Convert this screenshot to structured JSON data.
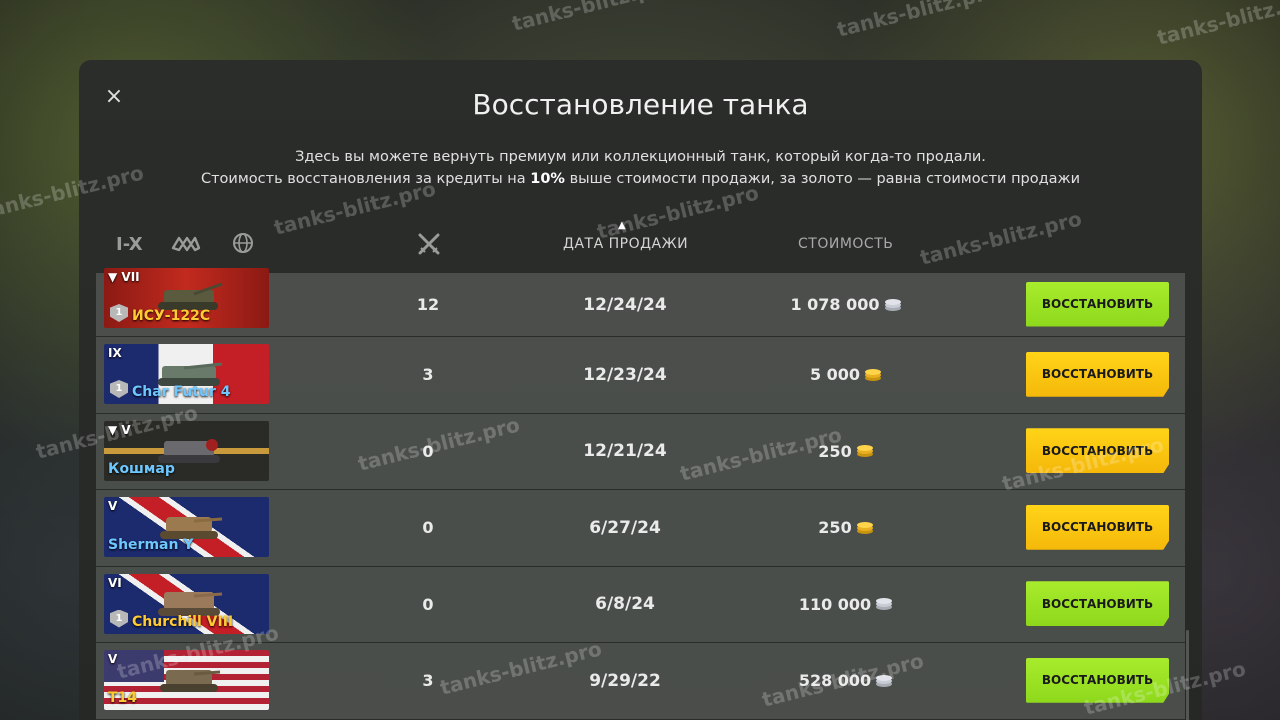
{
  "dialog": {
    "title": "Восстановление танка",
    "subtitle_line1": "Здесь вы можете вернуть премиум или коллекционный танк, который когда-то продали.",
    "subtitle_line2_pre": "Стоимость восстановления за кредиты на ",
    "subtitle_line2_bold": "10%",
    "subtitle_line2_post": " выше стоимости продажи, за золото — равна стоимости продажи",
    "close_icon": "×"
  },
  "header": {
    "filter_tier": "I-X",
    "filter_type_icon": "vehicle-type-icon",
    "filter_nation_icon": "globe-icon",
    "battles_icon": "crossed-swords-icon",
    "col_date": "ДАТА ПРОДАЖИ",
    "col_cost": "СТОИМОСТЬ"
  },
  "colors": {
    "credits": "#c8ccd4",
    "gold": "#f2c52a",
    "button_green": "#9be224",
    "button_yellow": "#fcc816",
    "name_gold": "#ffcc33",
    "name_blue": "#6ec8ff"
  },
  "tanks": [
    {
      "tier": "▼ VII",
      "name": "ИСУ-122С",
      "name_color": "gold",
      "badge": "1",
      "battles": "12",
      "date": "12/24/24",
      "cost": "1 078 000",
      "currency": "credits",
      "button": "ВОССТАНОВИТЬ",
      "button_color": "green"
    },
    {
      "tier": "IX",
      "name": "Char Futur 4",
      "name_color": "blue",
      "badge": "1",
      "battles": "3",
      "date": "12/23/24",
      "cost": "5 000",
      "currency": "gold",
      "button": "ВОССТАНОВИТЬ",
      "button_color": "yellow"
    },
    {
      "tier": "▼ V",
      "name": "Кошмар",
      "name_color": "blue",
      "badge": "",
      "battles": "0",
      "date": "12/21/24",
      "cost": "250",
      "currency": "gold",
      "button": "ВОССТАНОВИТЬ",
      "button_color": "yellow"
    },
    {
      "tier": "V",
      "name": "Sherman Y",
      "name_color": "blue",
      "badge": "",
      "battles": "0",
      "date": "6/27/24",
      "cost": "250",
      "currency": "gold",
      "button": "ВОССТАНОВИТЬ",
      "button_color": "yellow"
    },
    {
      "tier": "VI",
      "name": "Churchill VIII",
      "name_color": "gold",
      "badge": "1",
      "battles": "0",
      "date": "6/8/24",
      "cost": "110 000",
      "currency": "credits",
      "button": "ВОССТАНОВИТЬ",
      "button_color": "green"
    },
    {
      "tier": "V",
      "name": "T14",
      "name_color": "gold",
      "badge": "",
      "battles": "3",
      "date": "9/29/22",
      "cost": "528 000",
      "currency": "credits",
      "button": "ВОССТАНОВИТЬ",
      "button_color": "green"
    }
  ],
  "watermark": "tanks-blitz.pro"
}
